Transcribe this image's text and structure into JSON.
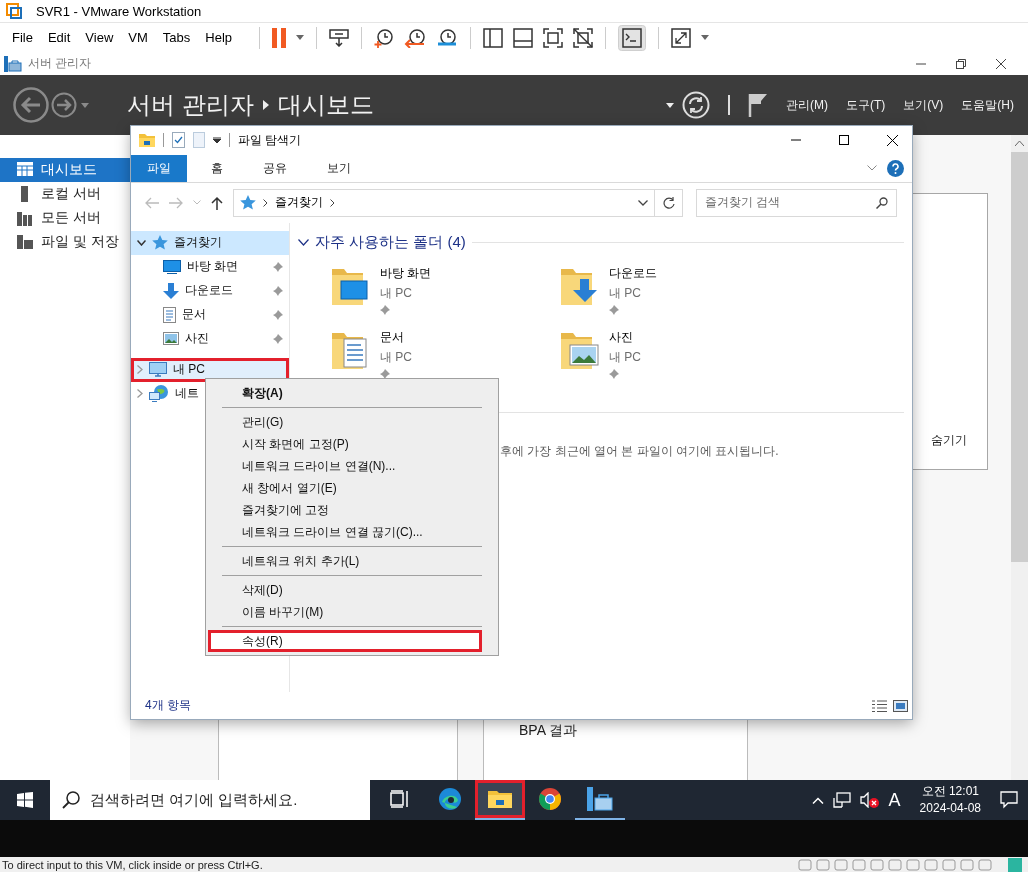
{
  "vmware": {
    "title": "SVR1 - VMware Workstation",
    "menu": [
      "File",
      "Edit",
      "View",
      "VM",
      "Tabs",
      "Help"
    ],
    "status": "To direct input to this VM, click inside or press Ctrl+G."
  },
  "server_manager": {
    "title": "서버 관리자",
    "breadcrumb": [
      "서버 관리자",
      "대시보드"
    ],
    "menu": [
      "관리(M)",
      "도구(T)",
      "보기(V)",
      "도움말(H)"
    ],
    "sidebar": [
      {
        "label": "대시보드",
        "kind": "dashboard",
        "selected": true
      },
      {
        "label": "로컬 서버",
        "kind": "server",
        "selected": false
      },
      {
        "label": "모든 서버",
        "kind": "servers",
        "selected": false
      },
      {
        "label": "파일 및 저장",
        "kind": "storage",
        "selected": false
      }
    ],
    "panel_link": "숨기기",
    "tile_title": "BPA 결과"
  },
  "explorer": {
    "title": "파일 탐색기",
    "ribbon_tabs": [
      {
        "label": "파일",
        "selected": true
      },
      {
        "label": "홈",
        "selected": false
      },
      {
        "label": "공유",
        "selected": false
      },
      {
        "label": "보기",
        "selected": false
      }
    ],
    "address": "즐겨찾기",
    "search": {
      "placeholder": "즐겨찾기 검색"
    },
    "nav": [
      {
        "label": "즐겨찾기",
        "kind": "star",
        "selected": true,
        "hovered": false,
        "expanded": true,
        "annotated": false,
        "children": [
          {
            "label": "바탕 화면",
            "kind": "desktop",
            "pinned": true
          },
          {
            "label": "다운로드",
            "kind": "download",
            "pinned": true
          },
          {
            "label": "문서",
            "kind": "document",
            "pinned": true
          },
          {
            "label": "사진",
            "kind": "picture",
            "pinned": true
          }
        ]
      },
      {
        "label": "내 PC",
        "kind": "pc",
        "selected": false,
        "hovered": true,
        "expanded": false,
        "annotated": true
      },
      {
        "label": "네트",
        "kind": "network",
        "selected": false,
        "hovered": false,
        "expanded": false,
        "annotated": false
      }
    ],
    "section": {
      "title": "자주 사용하는 폴더 (4)",
      "expanded": true
    },
    "folders": [
      {
        "name": "바탕 화면",
        "location": "내 PC",
        "kind": "desktop",
        "pinned": true
      },
      {
        "name": "다운로드",
        "location": "내 PC",
        "kind": "download",
        "pinned": true
      },
      {
        "name": "문서",
        "location": "내 PC",
        "kind": "document",
        "pinned": true
      },
      {
        "name": "사진",
        "location": "내 PC",
        "kind": "picture",
        "pinned": true
      }
    ],
    "recent_note": "후에 가장 최근에 열어 본 파일이 여기에 표시됩니다.",
    "status": "4개 항목"
  },
  "context_menu": [
    [
      {
        "label": "확장(A)",
        "default": true,
        "selected": false,
        "annotated": false
      }
    ],
    [
      {
        "label": "관리(G)",
        "default": false,
        "selected": false,
        "annotated": false
      },
      {
        "label": "시작 화면에 고정(P)",
        "default": false,
        "selected": false,
        "annotated": false
      },
      {
        "label": "네트워크 드라이브 연결(N)...",
        "default": false,
        "selected": false,
        "annotated": false
      },
      {
        "label": "새 창에서 열기(E)",
        "default": false,
        "selected": false,
        "annotated": false
      },
      {
        "label": "즐겨찾기에 고정",
        "default": false,
        "selected": false,
        "annotated": false
      },
      {
        "label": "네트워크 드라이브 연결 끊기(C)...",
        "default": false,
        "selected": false,
        "annotated": false
      }
    ],
    [
      {
        "label": "네트워크 위치 추가(L)",
        "default": false,
        "selected": false,
        "annotated": false
      }
    ],
    [
      {
        "label": "삭제(D)",
        "default": false,
        "selected": false,
        "annotated": false
      },
      {
        "label": "이름 바꾸기(M)",
        "default": false,
        "selected": false,
        "annotated": false
      }
    ],
    [
      {
        "label": "속성(R)",
        "default": false,
        "selected": true,
        "annotated": true
      }
    ]
  ],
  "taskbar": {
    "search": {
      "placeholder": "검색하려면 여기에 입력하세요."
    },
    "apps": [
      {
        "kind": "task-view",
        "open": false,
        "active": false,
        "annotated": false
      },
      {
        "kind": "edge",
        "open": false,
        "active": false,
        "annotated": false
      },
      {
        "kind": "explorer",
        "open": true,
        "active": true,
        "annotated": true
      },
      {
        "kind": "chrome",
        "open": false,
        "active": false,
        "annotated": false
      },
      {
        "kind": "server-manager",
        "open": true,
        "active": false,
        "annotated": false
      }
    ],
    "ime": "A",
    "clock": {
      "time": "오전 12:01",
      "date": "2024-04-08"
    }
  }
}
